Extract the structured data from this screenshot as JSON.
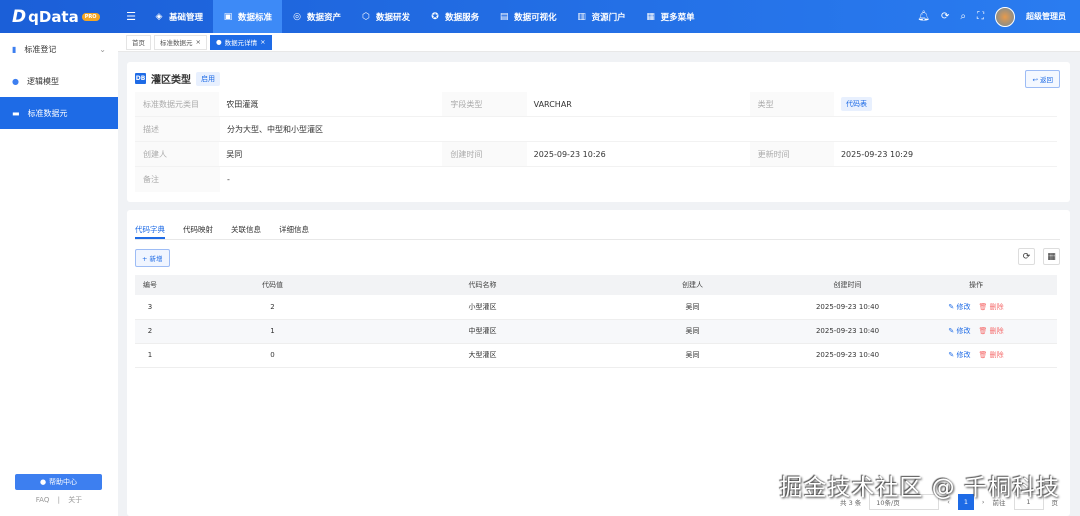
{
  "app": {
    "logo": "qData",
    "badge": "PRO"
  },
  "nav": [
    {
      "label": "基础管理",
      "icon": "cube-icon"
    },
    {
      "label": "数据标准",
      "icon": "book-icon"
    },
    {
      "label": "数据资产",
      "icon": "target-icon"
    },
    {
      "label": "数据研发",
      "icon": "box-icon"
    },
    {
      "label": "数据服务",
      "icon": "service-icon"
    },
    {
      "label": "数据可视化",
      "icon": "chart-icon"
    },
    {
      "label": "资源门户",
      "icon": "portal-icon"
    },
    {
      "label": "更多菜单",
      "icon": "grid-icon"
    }
  ],
  "user": {
    "name": "超级管理员"
  },
  "sidebar": {
    "items": [
      {
        "label": "标准登记"
      },
      {
        "label": "逻辑模型"
      },
      {
        "label": "标准数据元"
      }
    ],
    "help": "帮助中心",
    "faq": "FAQ",
    "sep": "|",
    "about": "关于"
  },
  "tabs": [
    {
      "label": "首页"
    },
    {
      "label": "标准数据元"
    },
    {
      "label": "数据元详情"
    }
  ],
  "detail": {
    "title": "灌区类型",
    "status": "启用",
    "back": "返回",
    "fields": {
      "category_label": "标准数据元类目",
      "category": "农田灌溉",
      "fieldtype_label": "字段类型",
      "fieldtype": "VARCHAR",
      "type_label": "类型",
      "type": "代码表",
      "desc_label": "描述",
      "desc": "分为大型、中型和小型灌区",
      "creator_label": "创建人",
      "creator": "吴同",
      "ctime_label": "创建时间",
      "ctime": "2025-09-23 10:26",
      "utime_label": "更新时间",
      "utime": "2025-09-23 10:29",
      "remark_label": "备注",
      "remark": "-"
    }
  },
  "subtabs": [
    "代码字典",
    "代码映射",
    "关联信息",
    "详细信息"
  ],
  "add": "+ 新增",
  "table": {
    "headers": [
      "编号",
      "代码值",
      "代码名称",
      "创建人",
      "创建时间",
      "操作"
    ],
    "edit": "修改",
    "delete": "删除",
    "rows": [
      [
        "3",
        "2",
        "小型灌区",
        "吴同",
        "2025-09-23 10:40"
      ],
      [
        "2",
        "1",
        "中型灌区",
        "吴同",
        "2025-09-23 10:40"
      ],
      [
        "1",
        "0",
        "大型灌区",
        "吴同",
        "2025-09-23 10:40"
      ]
    ]
  },
  "pager": {
    "total": "共 3 条",
    "size": "10条/页",
    "current": "1",
    "goto": "前往",
    "page_input": "1",
    "page_suffix": "页"
  },
  "watermark": "掘金技术社区 @ 千桐科技"
}
